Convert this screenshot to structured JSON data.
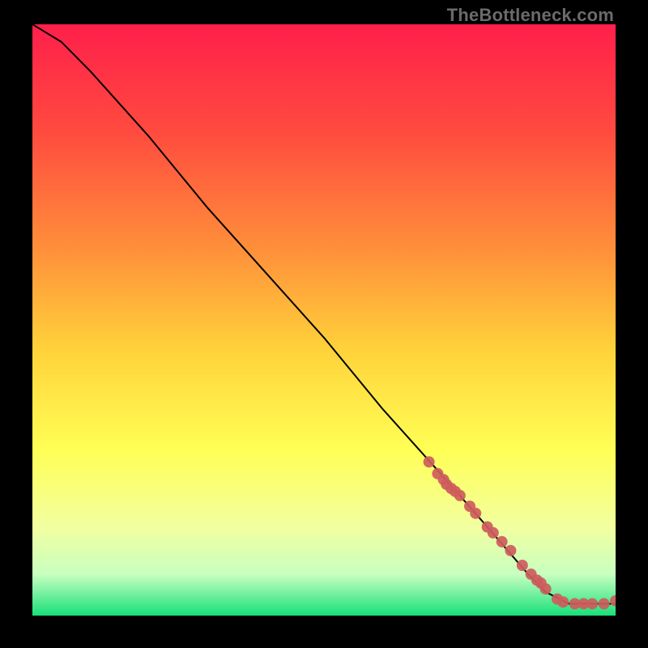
{
  "watermark": "TheBottleneck.com",
  "chart_data": {
    "type": "line",
    "title": "",
    "xlabel": "",
    "ylabel": "",
    "xlim": [
      0,
      100
    ],
    "ylim": [
      0,
      100
    ],
    "grid": false,
    "legend": false,
    "series": [
      {
        "name": "curve",
        "style": "line",
        "color": "#000000",
        "x": [
          0,
          5,
          10,
          20,
          30,
          40,
          50,
          60,
          70,
          78,
          85,
          88,
          92,
          96,
          100
        ],
        "y": [
          100,
          97,
          92,
          81,
          69,
          58,
          47,
          35,
          24,
          15,
          7,
          4,
          2,
          2,
          2
        ]
      },
      {
        "name": "markers",
        "style": "scatter",
        "color": "#cd5c5c",
        "x": [
          68,
          69.5,
          70.5,
          71,
          71.8,
          72.5,
          73.3,
          75,
          76,
          78,
          79,
          80.5,
          82,
          84,
          85.5,
          86.5,
          87.2,
          88,
          90,
          91,
          93,
          94.5,
          96,
          98,
          100
        ],
        "y": [
          26,
          24,
          23,
          22.2,
          21.5,
          21,
          20.3,
          18.5,
          17.3,
          15,
          14,
          12.5,
          11,
          8.5,
          7,
          6,
          5.5,
          4.5,
          2.8,
          2.3,
          2,
          2,
          2,
          2,
          2.5
        ]
      }
    ],
    "gradient_background": {
      "top": "#ff1f4b",
      "mid_top": "#ffa23a",
      "mid": "#ffe23a",
      "mid_bottom": "#f5ff7a",
      "band": "#b9ffb0",
      "bottom": "#18e07a"
    }
  }
}
